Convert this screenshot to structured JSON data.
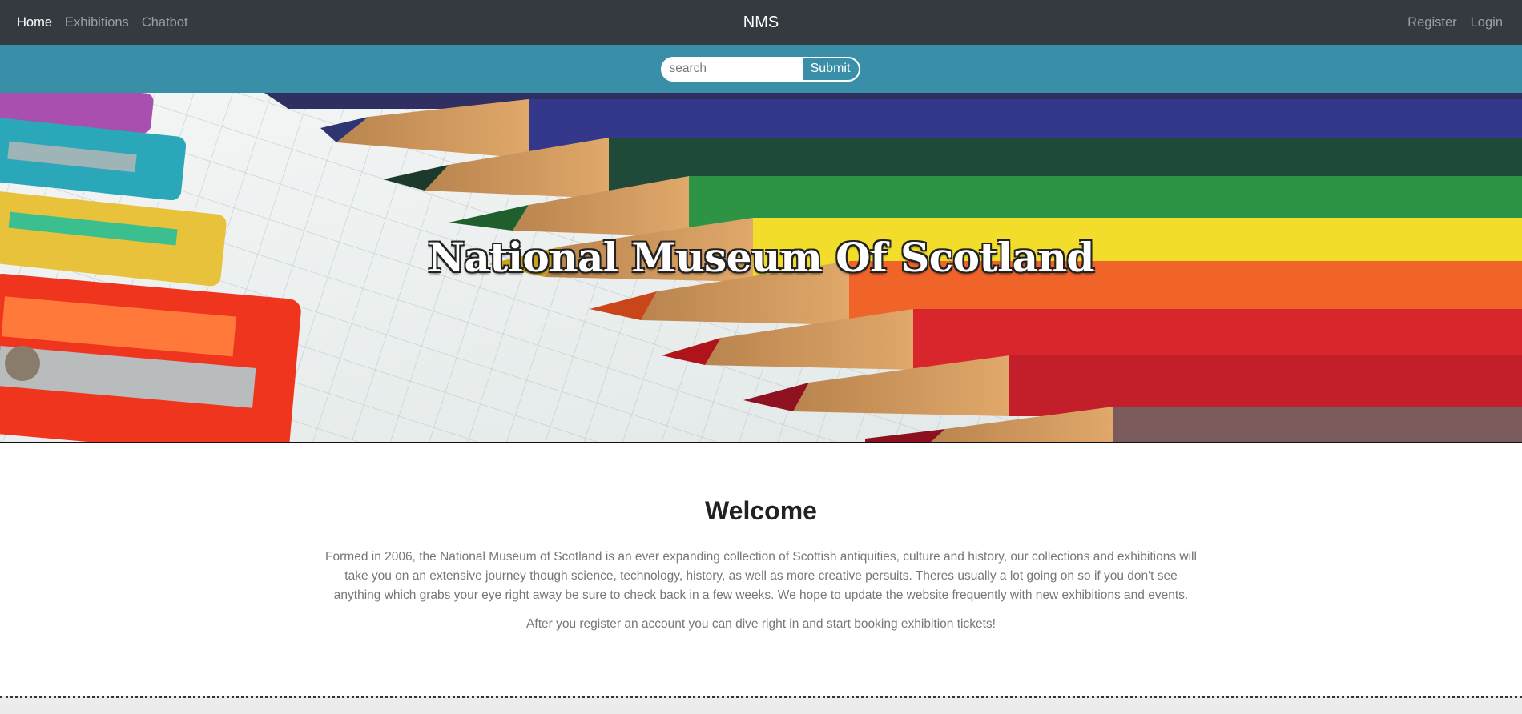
{
  "nav": {
    "left_links": [
      "Home",
      "Exhibitions",
      "Chatbot"
    ],
    "active": "Home",
    "brand": "NMS",
    "right_links": [
      "Register",
      "Login"
    ]
  },
  "search": {
    "placeholder": "search",
    "value": "",
    "submit_label": "Submit"
  },
  "hero": {
    "title": "National Museum Of Scotland"
  },
  "welcome": {
    "heading": "Welcome",
    "intro": "Formed in 2006, the National Museum of Scotland is an ever expanding collection of Scottish antiquities, culture and history, our collections and exhibitions will take you on an extensive journey though science, technology, history, as well as more creative persuits. Theres usually a lot going on so if you don't see anything which grabs your eye right away be sure to check back in a few weeks. We hope to update the website frequently with new exhibitions and events.",
    "cta": "After you register an account you can dive right in and start booking exhibition tickets!"
  },
  "colors": {
    "navbar_bg": "#343a40",
    "searchbar_bg": "#398ea8",
    "text_muted": "#777777"
  }
}
